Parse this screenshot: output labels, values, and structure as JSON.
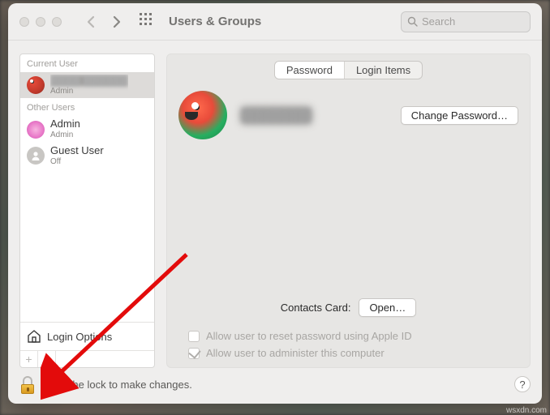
{
  "window": {
    "title": "Users & Groups"
  },
  "search": {
    "placeholder": "Search"
  },
  "sidebar": {
    "current_header": "Current User",
    "current": {
      "name": "████ ██████",
      "role": "Admin"
    },
    "other_header": "Other Users",
    "others": [
      {
        "name": "Admin",
        "role": "Admin"
      },
      {
        "name": "Guest User",
        "role": "Off"
      }
    ],
    "login_options": "Login Options",
    "add": "+",
    "remove": "−"
  },
  "tabs": {
    "password": "Password",
    "login_items": "Login Items"
  },
  "main": {
    "user_display_name": "████████",
    "change_password": "Change Password…",
    "contacts_label": "Contacts Card:",
    "open": "Open…",
    "allow_reset": "Allow user to reset password using Apple ID",
    "allow_admin": "Allow user to administer this computer"
  },
  "footer": {
    "lock_text": "Click the lock to make changes.",
    "help": "?"
  },
  "watermark": "wsxdn.com"
}
